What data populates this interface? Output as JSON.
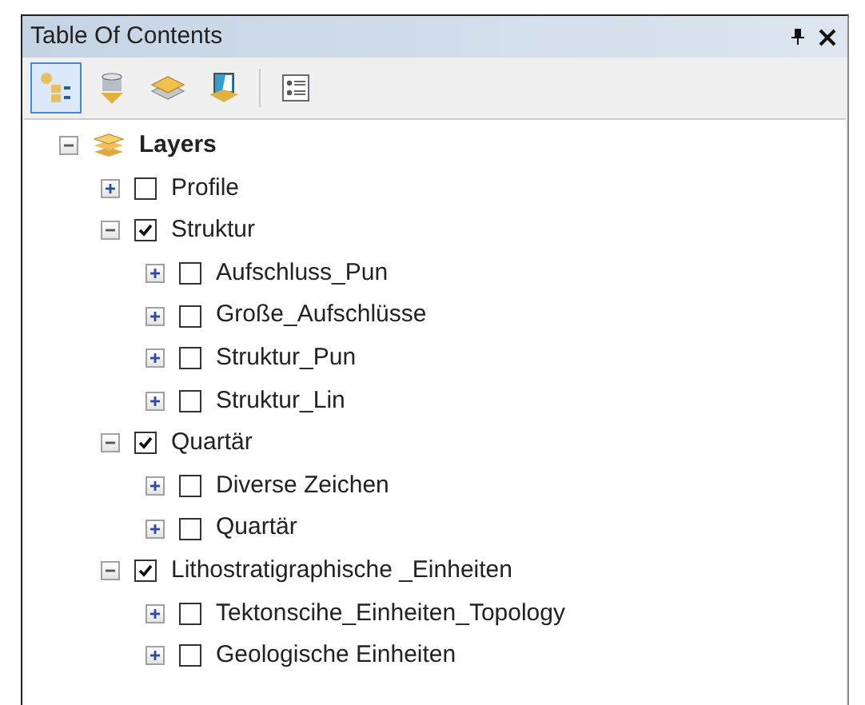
{
  "window": {
    "title": "Table Of Contents"
  },
  "toolbar": [
    {
      "kind": "drawing-order",
      "selected": true
    },
    {
      "kind": "source",
      "selected": false
    },
    {
      "kind": "visibility",
      "selected": false
    },
    {
      "kind": "selection",
      "selected": false
    },
    {
      "kind": "options",
      "selected": false
    }
  ],
  "tree": {
    "label": "Layers",
    "expanded": true,
    "children": [
      {
        "label": "Profile",
        "checked": false,
        "expanded": false
      },
      {
        "label": "Struktur",
        "checked": true,
        "expanded": true,
        "children": [
          {
            "label": "Aufschluss_Pun",
            "checked": false,
            "expanded": false
          },
          {
            "label": "Große_Aufschlüsse",
            "checked": false,
            "expanded": false
          },
          {
            "label": "Struktur_Pun",
            "checked": false,
            "expanded": false
          },
          {
            "label": "Struktur_Lin",
            "checked": false,
            "expanded": false
          }
        ]
      },
      {
        "label": "Quartär",
        "checked": true,
        "expanded": true,
        "children": [
          {
            "label": "Diverse Zeichen",
            "checked": false,
            "expanded": false
          },
          {
            "label": "Quartär",
            "checked": false,
            "expanded": false
          }
        ]
      },
      {
        "label": "Lithostratigraphische _Einheiten",
        "checked": true,
        "expanded": true,
        "children": [
          {
            "label": "Tektonscihe_Einheiten_Topology",
            "checked": false,
            "expanded": false
          },
          {
            "label": "Geologische Einheiten",
            "checked": false,
            "expanded": false
          }
        ]
      }
    ]
  }
}
